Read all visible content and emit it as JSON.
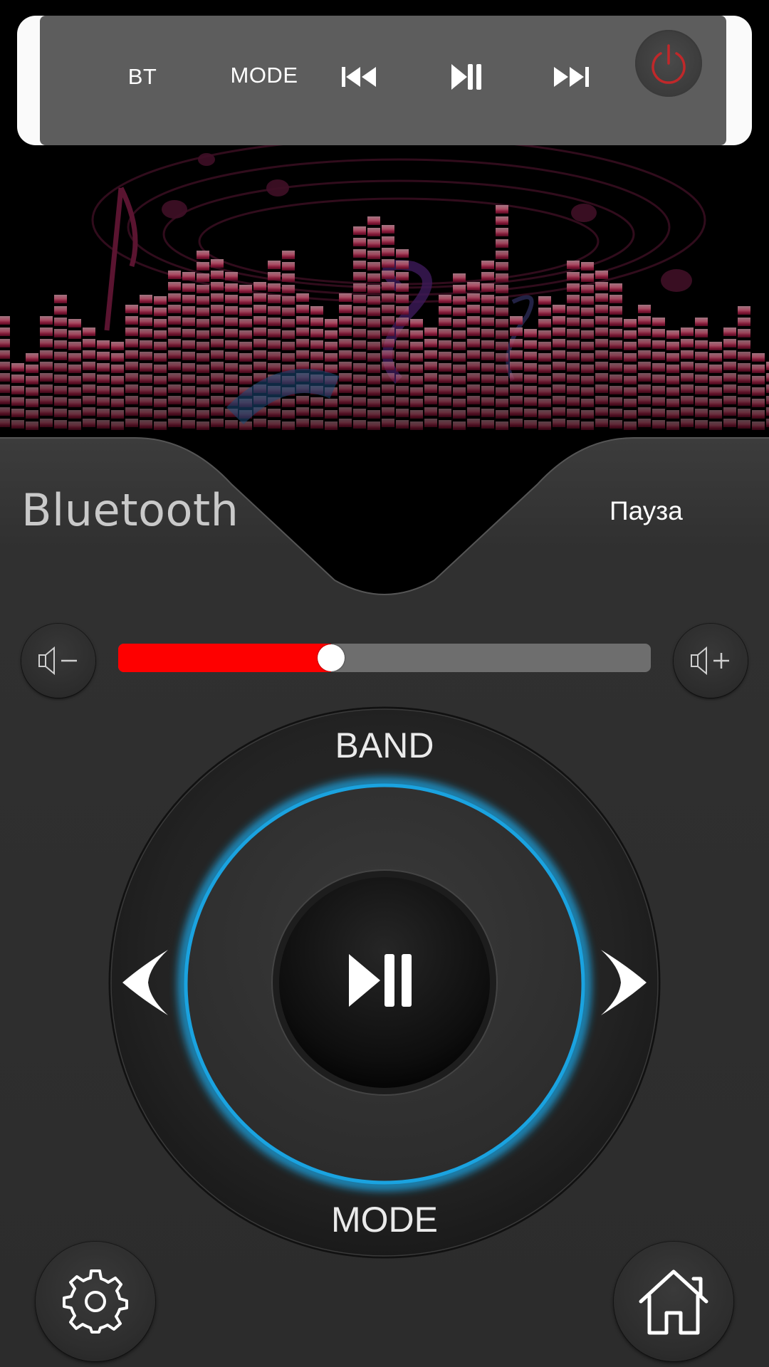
{
  "topbar": {
    "bt_label": "BT",
    "mode_label": "MODE",
    "icons": [
      "skip-previous-icon",
      "play-pause-icon",
      "skip-next-icon",
      "power-icon"
    ],
    "power_color": "#c0282a"
  },
  "status": {
    "source": "Bluetooth",
    "playback": "Пауза"
  },
  "volume": {
    "level": 0.4,
    "fill_color": "#fe0000",
    "icons": [
      "volume-down-icon",
      "volume-up-icon"
    ]
  },
  "dial": {
    "top_label": "BAND",
    "bottom_label": "MODE",
    "ring_color": "#1aa3e0",
    "icons": [
      "arrow-left-icon",
      "arrow-right-icon",
      "play-pause-icon"
    ]
  },
  "bottom": {
    "icons": [
      "settings-gear-icon",
      "home-icon"
    ]
  }
}
